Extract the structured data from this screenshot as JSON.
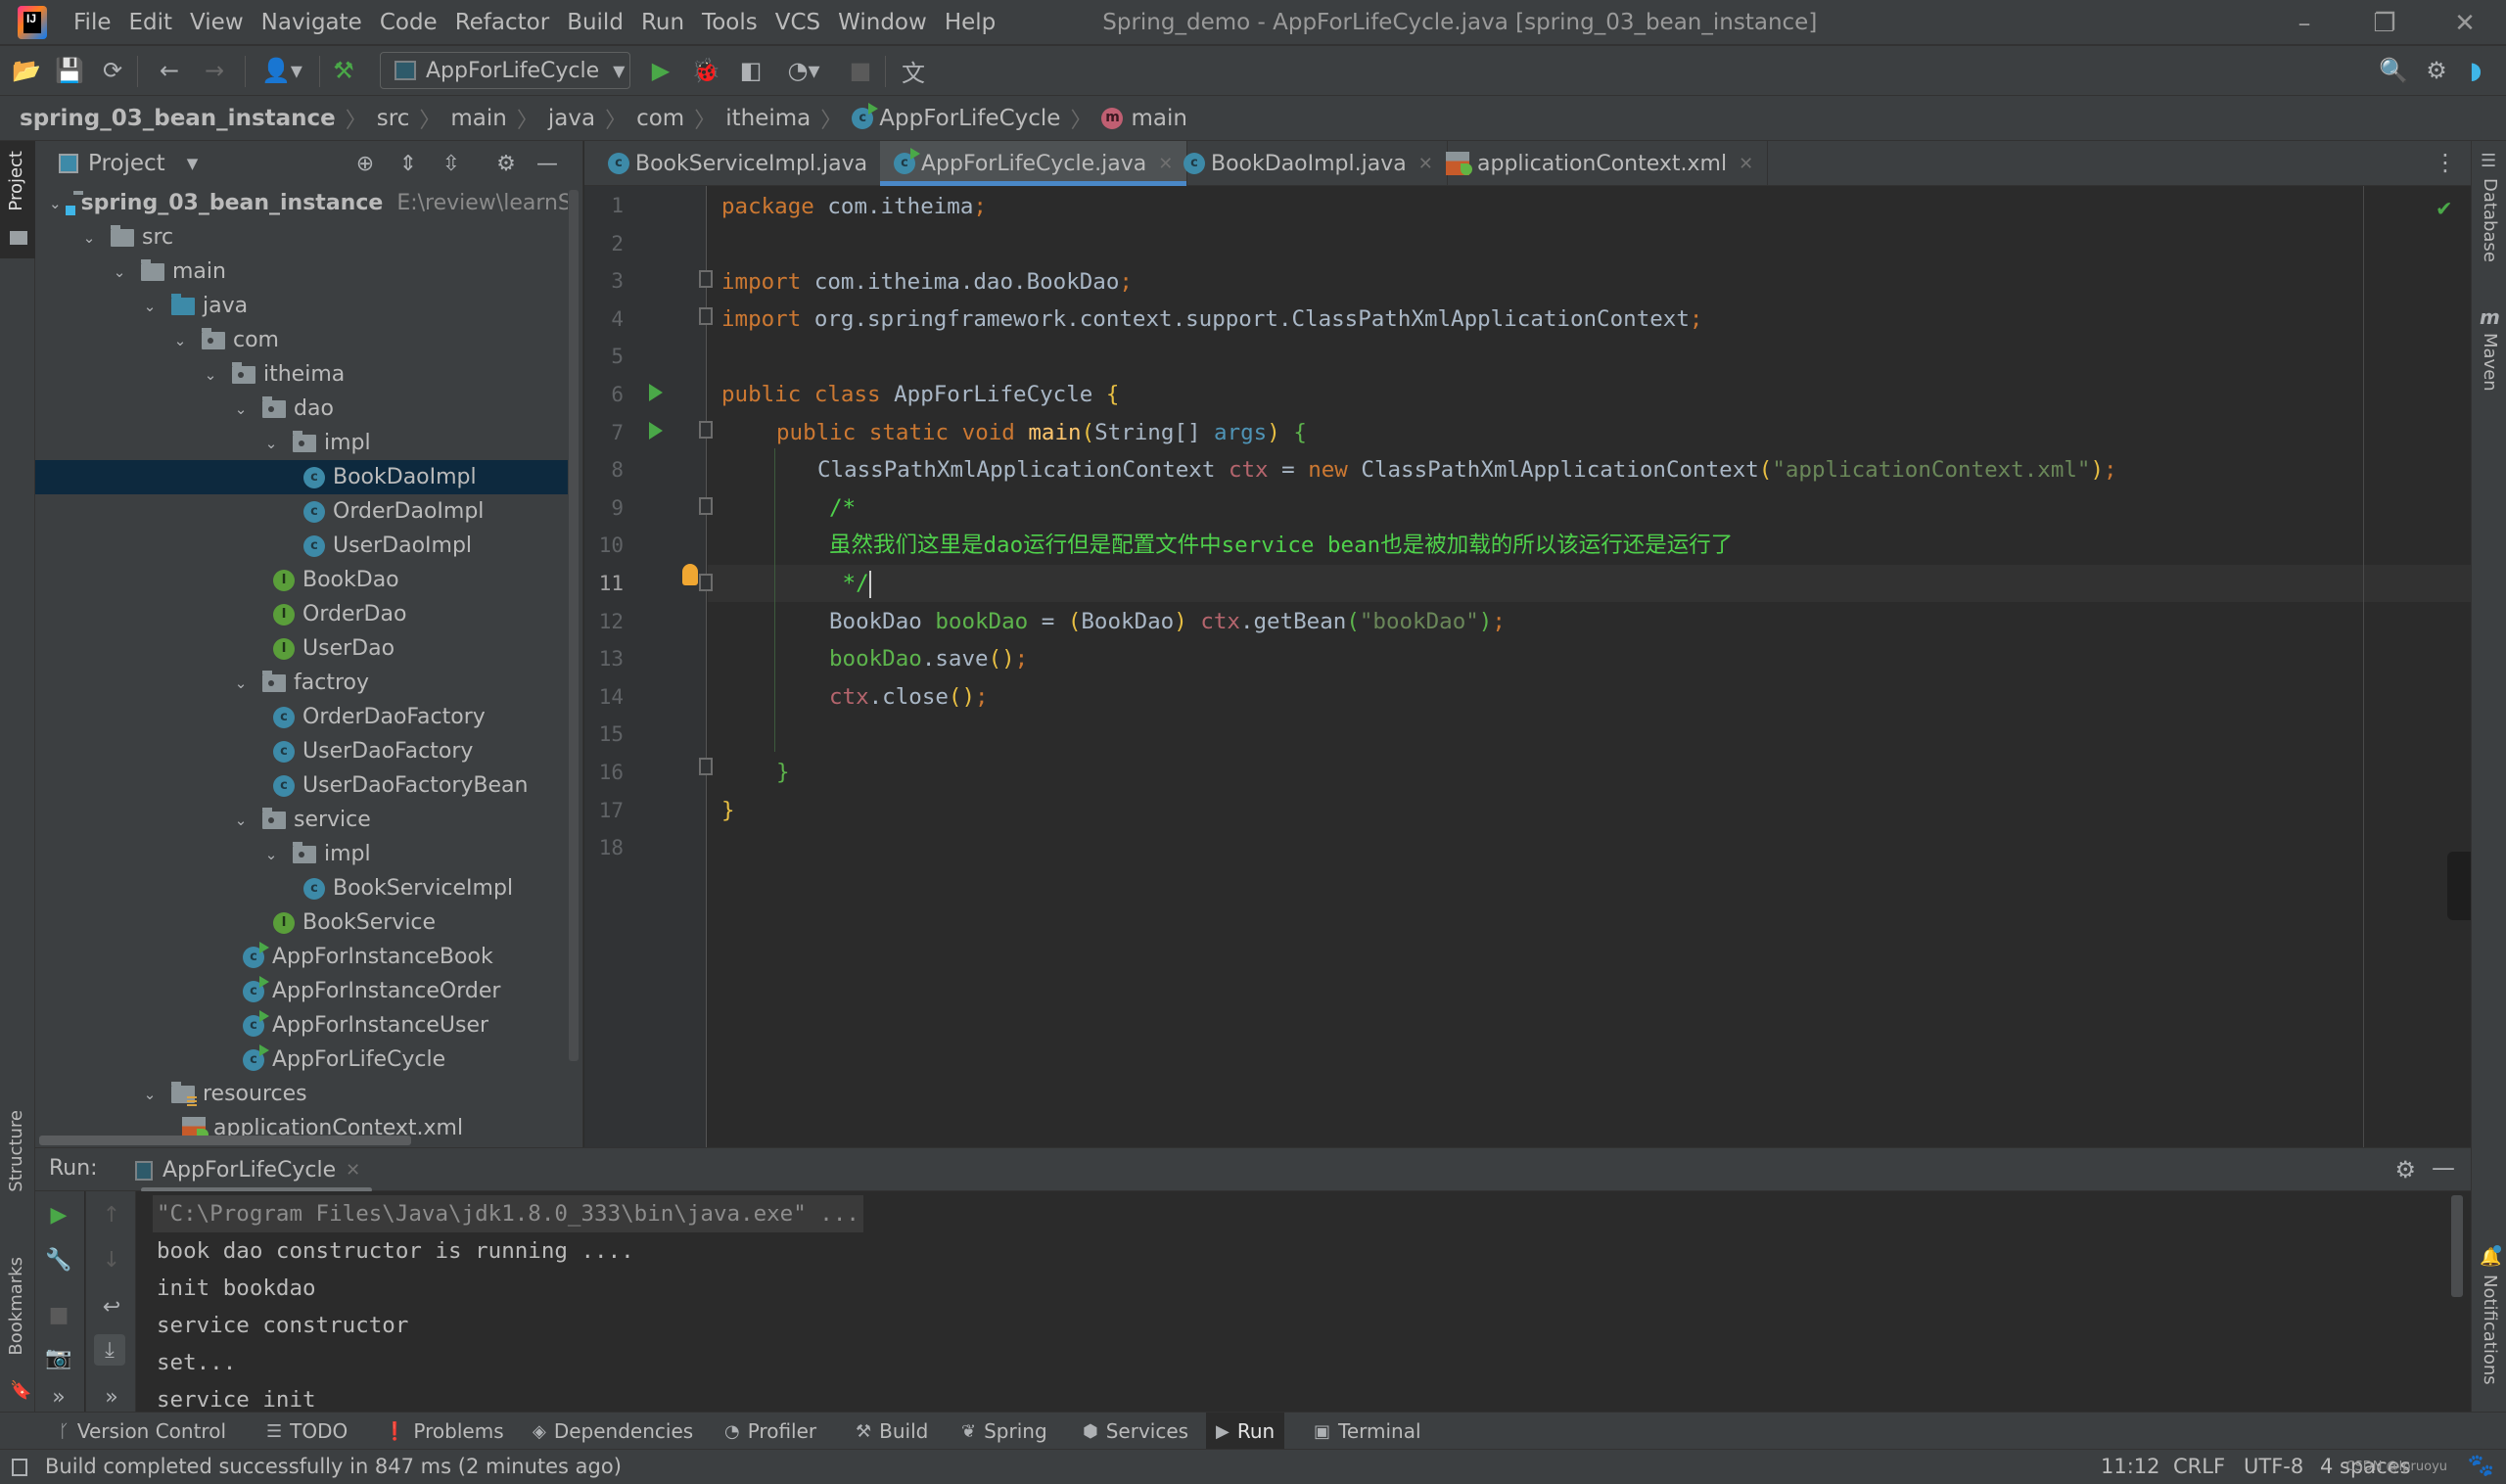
{
  "menubar": {
    "items": [
      "File",
      "Edit",
      "View",
      "Navigate",
      "Code",
      "Refactor",
      "Build",
      "Run",
      "Tools",
      "VCS",
      "Window",
      "Help"
    ],
    "window_title": "Spring_demo - AppForLifeCycle.java [spring_03_bean_instance]",
    "controls": {
      "minimize": "–",
      "restore": "❐",
      "close": "✕"
    }
  },
  "toolbar": {
    "run_config": "AppForLifeCycle",
    "icons": [
      "open-folder",
      "save",
      "sync",
      "back",
      "forward",
      "user",
      "build-hammer",
      "run",
      "debug",
      "coverage",
      "profile",
      "stop",
      "translate",
      "search",
      "settings",
      "toolbox"
    ]
  },
  "breadcrumb": {
    "items": [
      "spring_03_bean_instance",
      "src",
      "main",
      "java",
      "com",
      "itheima",
      "AppForLifeCycle",
      "main"
    ]
  },
  "project_panel": {
    "title": "Project",
    "tree": [
      {
        "label": "spring_03_bean_instance",
        "path": "E:\\review\\learnSpring",
        "type": "module",
        "depth": 0,
        "expanded": true
      },
      {
        "label": "src",
        "type": "folder",
        "depth": 1,
        "expanded": true
      },
      {
        "label": "main",
        "type": "folder",
        "depth": 2,
        "expanded": true
      },
      {
        "label": "java",
        "type": "source",
        "depth": 3,
        "expanded": true
      },
      {
        "label": "com",
        "type": "package",
        "depth": 4,
        "expanded": true
      },
      {
        "label": "itheima",
        "type": "package",
        "depth": 5,
        "expanded": true
      },
      {
        "label": "dao",
        "type": "package",
        "depth": 6,
        "expanded": true
      },
      {
        "label": "impl",
        "type": "package",
        "depth": 7,
        "expanded": true
      },
      {
        "label": "BookDaoImpl",
        "type": "class",
        "depth": 8,
        "selected": true
      },
      {
        "label": "OrderDaoImpl",
        "type": "class",
        "depth": 8
      },
      {
        "label": "UserDaoImpl",
        "type": "class",
        "depth": 8
      },
      {
        "label": "BookDao",
        "type": "interface",
        "depth": 7
      },
      {
        "label": "OrderDao",
        "type": "interface",
        "depth": 7
      },
      {
        "label": "UserDao",
        "type": "interface",
        "depth": 7
      },
      {
        "label": "factroy",
        "type": "package",
        "depth": 6,
        "expanded": true
      },
      {
        "label": "OrderDaoFactory",
        "type": "class",
        "depth": 7
      },
      {
        "label": "UserDaoFactory",
        "type": "class",
        "depth": 7
      },
      {
        "label": "UserDaoFactoryBean",
        "type": "class",
        "depth": 7
      },
      {
        "label": "service",
        "type": "package",
        "depth": 6,
        "expanded": true
      },
      {
        "label": "impl",
        "type": "package",
        "depth": 7,
        "expanded": true
      },
      {
        "label": "BookServiceImpl",
        "type": "class",
        "depth": 8
      },
      {
        "label": "BookService",
        "type": "interface",
        "depth": 7
      },
      {
        "label": "AppForInstanceBook",
        "type": "runclass",
        "depth": 6
      },
      {
        "label": "AppForInstanceOrder",
        "type": "runclass",
        "depth": 6
      },
      {
        "label": "AppForInstanceUser",
        "type": "runclass",
        "depth": 6
      },
      {
        "label": "AppForLifeCycle",
        "type": "runclass",
        "depth": 6
      },
      {
        "label": "resources",
        "type": "resources",
        "depth": 3,
        "expanded": true
      },
      {
        "label": "applicationContext.xml",
        "type": "xml",
        "depth": 4
      }
    ]
  },
  "editor_tabs": [
    {
      "label": "BookServiceImpl.java",
      "icon": "class",
      "active": false
    },
    {
      "label": "AppForLifeCycle.java",
      "icon": "runclass",
      "active": true
    },
    {
      "label": "BookDaoImpl.java",
      "icon": "class",
      "active": false
    },
    {
      "label": "applicationContext.xml",
      "icon": "xml",
      "active": false
    }
  ],
  "editor": {
    "current_line": 11,
    "line_numbers": [
      "1",
      "2",
      "3",
      "4",
      "5",
      "6",
      "7",
      "8",
      "9",
      "10",
      "11",
      "12",
      "13",
      "14",
      "15",
      "16",
      "17",
      "18"
    ],
    "code": {
      "l1": [
        "package",
        " com.itheima",
        ";"
      ],
      "l3": [
        "import",
        " com.itheima.dao.BookDao",
        ";"
      ],
      "l4": [
        "import",
        " org.springframework.context.support.ClassPathXmlApplicationContext",
        ";"
      ],
      "l6": [
        "public class",
        " AppForLifeCycle ",
        "{"
      ],
      "l7": [
        "public static void",
        " ",
        "main",
        "(",
        "String[] ",
        "args",
        ")",
        " ",
        "{"
      ],
      "l8": [
        "ClassPathXmlApplicationContext ",
        "ctx",
        " = ",
        "new",
        " ClassPathXmlApplicationContext",
        "(",
        "\"applicationContext.xml\"",
        ")",
        ";"
      ],
      "l9": "/*",
      "l10": "虽然我们这里是dao运行但是配置文件中service bean也是被加载的所以该运行还是运行了",
      "l11": " */",
      "l12": [
        "BookDao ",
        "bookDao",
        " = ",
        "(",
        "BookDao",
        ")",
        " ",
        "ctx",
        ".getBean",
        "(",
        "\"bookDao\"",
        ")",
        ";"
      ],
      "l13": [
        "bookDao",
        ".save",
        "()",
        ";"
      ],
      "l14": [
        "ctx",
        ".close",
        "()",
        ";"
      ],
      "l16": "}",
      "l17": "}"
    }
  },
  "run_panel": {
    "label": "Run:",
    "tab": "AppForLifeCycle",
    "output": [
      "\"C:\\Program Files\\Java\\jdk1.8.0_333\\bin\\java.exe\" ...",
      "book dao constructor is running ....",
      "init bookdao",
      "service constructor",
      "set...",
      "service init"
    ]
  },
  "bottom_tabs": [
    {
      "label": "Version Control",
      "icon": "ᚴ"
    },
    {
      "label": "TODO",
      "icon": "☰"
    },
    {
      "label": "Problems",
      "icon": "❗"
    },
    {
      "label": "Dependencies",
      "icon": "◈"
    },
    {
      "label": "Profiler",
      "icon": "◔"
    },
    {
      "label": "Build",
      "icon": "⚒"
    },
    {
      "label": "Spring",
      "icon": "❦"
    },
    {
      "label": "Services",
      "icon": "⬢"
    },
    {
      "label": "Run",
      "icon": "▶",
      "active": true
    },
    {
      "label": "Terminal",
      "icon": "▣"
    }
  ],
  "right_stripe": {
    "database": "Database",
    "maven": "Maven",
    "notifications": "Notifications"
  },
  "left_stripe": {
    "project": "Project",
    "structure": "Structure",
    "bookmarks": "Bookmarks"
  },
  "statusbar": {
    "message": "Build completed successfully in 847 ms (2 minutes ago)",
    "position": "11:12",
    "line_ending": "CRLF",
    "encoding": "UTF-8",
    "indent": "4 spaces",
    "watermark": "CSDN @lpruoyu"
  }
}
